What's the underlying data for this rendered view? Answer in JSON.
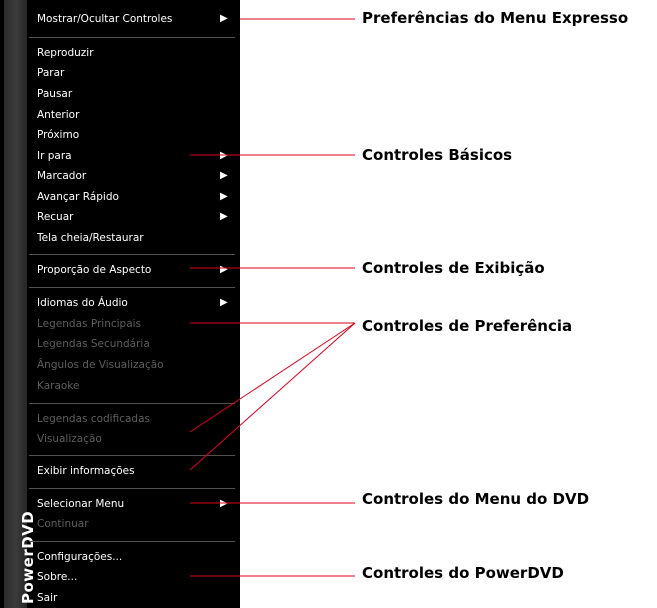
{
  "brand": "PowerDVD",
  "menu": {
    "items": [
      {
        "id": "show-hide-controls",
        "label": "Mostrar/Ocultar Controles",
        "submenu": true,
        "enabled": true
      },
      {
        "id": "play",
        "label": "Reproduzir",
        "submenu": false,
        "enabled": true
      },
      {
        "id": "stop",
        "label": "Parar",
        "submenu": false,
        "enabled": true
      },
      {
        "id": "pause",
        "label": "Pausar",
        "submenu": false,
        "enabled": true
      },
      {
        "id": "previous",
        "label": "Anterior",
        "submenu": false,
        "enabled": true
      },
      {
        "id": "next",
        "label": "Próximo",
        "submenu": false,
        "enabled": true
      },
      {
        "id": "goto",
        "label": "Ir para",
        "submenu": true,
        "enabled": true
      },
      {
        "id": "bookmark",
        "label": "Marcador",
        "submenu": true,
        "enabled": true
      },
      {
        "id": "fast-forward",
        "label": "Avançar Rápido",
        "submenu": true,
        "enabled": true
      },
      {
        "id": "rewind",
        "label": "Recuar",
        "submenu": true,
        "enabled": true
      },
      {
        "id": "fullscreen",
        "label": "Tela cheia/Restaurar",
        "submenu": false,
        "enabled": true
      },
      {
        "id": "aspect-ratio",
        "label": "Proporção de Aspecto",
        "submenu": true,
        "enabled": true
      },
      {
        "id": "audio-languages",
        "label": "Idiomas do Áudio",
        "submenu": true,
        "enabled": true
      },
      {
        "id": "main-subtitles",
        "label": "Legendas Principais",
        "submenu": false,
        "enabled": false
      },
      {
        "id": "secondary-subtitles",
        "label": "Legendas Secundária",
        "submenu": false,
        "enabled": false
      },
      {
        "id": "viewing-angles",
        "label": "Ângulos de Visualização",
        "submenu": false,
        "enabled": false
      },
      {
        "id": "karaoke",
        "label": "Karaoke",
        "submenu": false,
        "enabled": false
      },
      {
        "id": "closed-captions",
        "label": "Legendas codificadas",
        "submenu": false,
        "enabled": false
      },
      {
        "id": "preview",
        "label": "Visualização",
        "submenu": false,
        "enabled": false
      },
      {
        "id": "show-info",
        "label": "Exibir informações",
        "submenu": false,
        "enabled": true
      },
      {
        "id": "select-menu",
        "label": "Selecionar Menu",
        "submenu": true,
        "enabled": true
      },
      {
        "id": "continue",
        "label": "Continuar",
        "submenu": false,
        "enabled": false
      },
      {
        "id": "settings",
        "label": "Configurações...",
        "submenu": false,
        "enabled": true
      },
      {
        "id": "about",
        "label": "Sobre...",
        "submenu": false,
        "enabled": true
      },
      {
        "id": "exit",
        "label": "Sair",
        "submenu": false,
        "enabled": true
      }
    ]
  },
  "callouts": [
    {
      "id": "express-menu-preferences",
      "text": "Preferências do Menu Expresso"
    },
    {
      "id": "basic-controls",
      "text": "Controles Básicos"
    },
    {
      "id": "display-controls",
      "text": "Controles de Exibição"
    },
    {
      "id": "preference-controls",
      "text": "Controles de Preferência"
    },
    {
      "id": "dvd-menu-controls",
      "text": "Controles do Menu do DVD"
    },
    {
      "id": "powerdvd-controls",
      "text": "Controles do PowerDVD"
    }
  ],
  "colors": {
    "menu_bg": "#000000",
    "enabled_text": "#ffffff",
    "disabled_text": "#5e5e5e",
    "leader_line": "#e0001a"
  }
}
